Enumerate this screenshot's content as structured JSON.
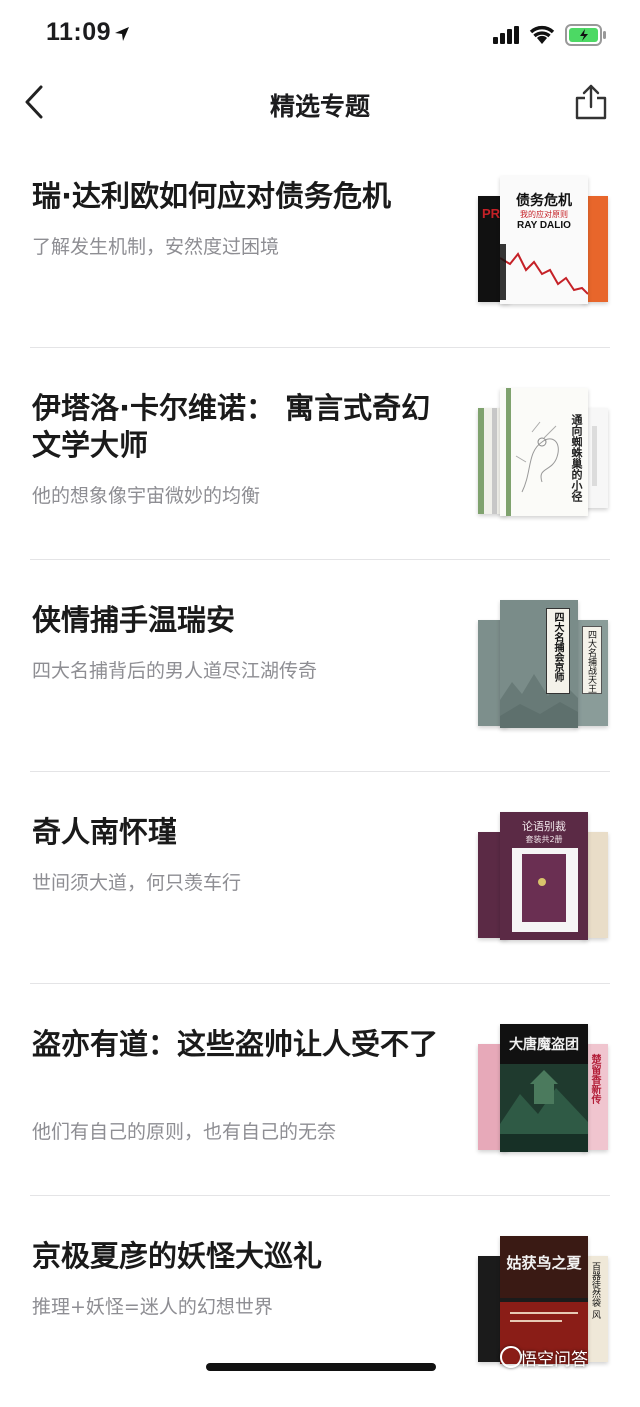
{
  "status_bar": {
    "time": "11:09"
  },
  "nav": {
    "title": "精选专题"
  },
  "topics": [
    {
      "title": "瑞·达利欧如何应对债务危机",
      "subtitle": "了解发生机制，安然度过困境",
      "cover": {
        "title": "债务危机",
        "subtitle": "我的应对原则",
        "author": "RAY DALIO",
        "side_left": "PR",
        "colors": [
          "#c52127",
          "#111111",
          "#e8662b"
        ]
      }
    },
    {
      "title": "伊塔洛·卡尔维诺： 寓言式奇幻文学大师",
      "subtitle": "他的想象像宇宙微妙的均衡",
      "cover": {
        "title": "通向蜘蛛巢的小径",
        "colors": [
          "#f4f4f0",
          "#7fa26e",
          "#c9c9c9"
        ]
      }
    },
    {
      "title": "侠情捕手温瑞安",
      "subtitle": "四大名捕背后的男人道尽江湖传奇",
      "cover": {
        "title": "四大名捕会京师",
        "title2": "四大名捕战天王",
        "colors": [
          "#7d8f8c",
          "#6a7a78"
        ]
      }
    },
    {
      "title": "奇人南怀瑾",
      "subtitle": "世间须大道，何只羡车行",
      "cover": {
        "title": "论语别裁",
        "subtitle": "套装共2册",
        "colors": [
          "#5b2a45",
          "#e9ddc8"
        ]
      }
    },
    {
      "title": "盗亦有道：这些盗帅让人受不了",
      "subtitle": "他们有自己的原则，也有自己的无奈",
      "cover": {
        "title": "大唐魔盗团",
        "title2": "楚留香新传",
        "colors": [
          "#1f3a2e",
          "#e7a9b9"
        ]
      }
    },
    {
      "title": "京极夏彦的妖怪大巡礼",
      "subtitle": "推理+妖怪=迷人的幻想世界",
      "cover": {
        "title": "姑获鸟之夏",
        "title2": "百器徒然袋 风",
        "colors": [
          "#1b1b1b",
          "#b0271f",
          "#efe8d8"
        ]
      }
    }
  ],
  "watermark": "悟空问答"
}
